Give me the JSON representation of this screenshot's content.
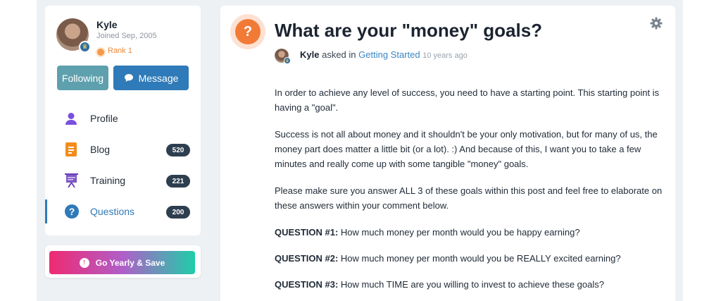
{
  "user": {
    "name": "Kyle",
    "joined": "Joined Sep, 2005",
    "rank": "Rank 1"
  },
  "buttons": {
    "following": "Following",
    "message": "Message"
  },
  "nav": {
    "items": [
      {
        "label": "Profile",
        "count": ""
      },
      {
        "label": "Blog",
        "count": "520"
      },
      {
        "label": "Training",
        "count": "221"
      },
      {
        "label": "Questions",
        "count": "200"
      }
    ]
  },
  "promo": {
    "label": "Go Yearly & Save"
  },
  "question": {
    "title": "What are your \"money\" goals?",
    "author": "Kyle",
    "asked_in": "asked in",
    "category": "Getting Started",
    "time_ago": "10 years ago",
    "paragraphs": [
      "In order to achieve any level of success, you need to have a starting point. This starting point is having a \"goal\".",
      "Success is not all about money and it shouldn't be your only motivation, but for many of us, the money part does matter a little bit (or a lot). :) And because of this, I want you to take a few minutes and really come up with some tangible \"money\" goals.",
      "Please make sure you answer ALL 3 of these goals within this post and feel free to elaborate on these answers within your comment below."
    ],
    "questions": [
      {
        "label": "QUESTION #1:",
        "text": "How much money per month would you be happy earning?"
      },
      {
        "label": "QUESTION #2:",
        "text": "How much money per month would you be REALLY excited earning?"
      },
      {
        "label": "QUESTION #3:",
        "text": "How much TIME are you willing to invest to achieve these goals?"
      }
    ]
  },
  "colors": {
    "accent_blue": "#2f7ab8",
    "following_teal": "#5ea0ad",
    "question_orange": "#f07a36",
    "count_badge": "#2d3e4f"
  },
  "icons": {
    "profile": "user-icon",
    "blog": "document-icon",
    "training": "presentation-icon",
    "questions": "question-icon",
    "message": "chat-bubble-icon",
    "settings": "gear-icon",
    "promo": "up-arrow-icon"
  }
}
